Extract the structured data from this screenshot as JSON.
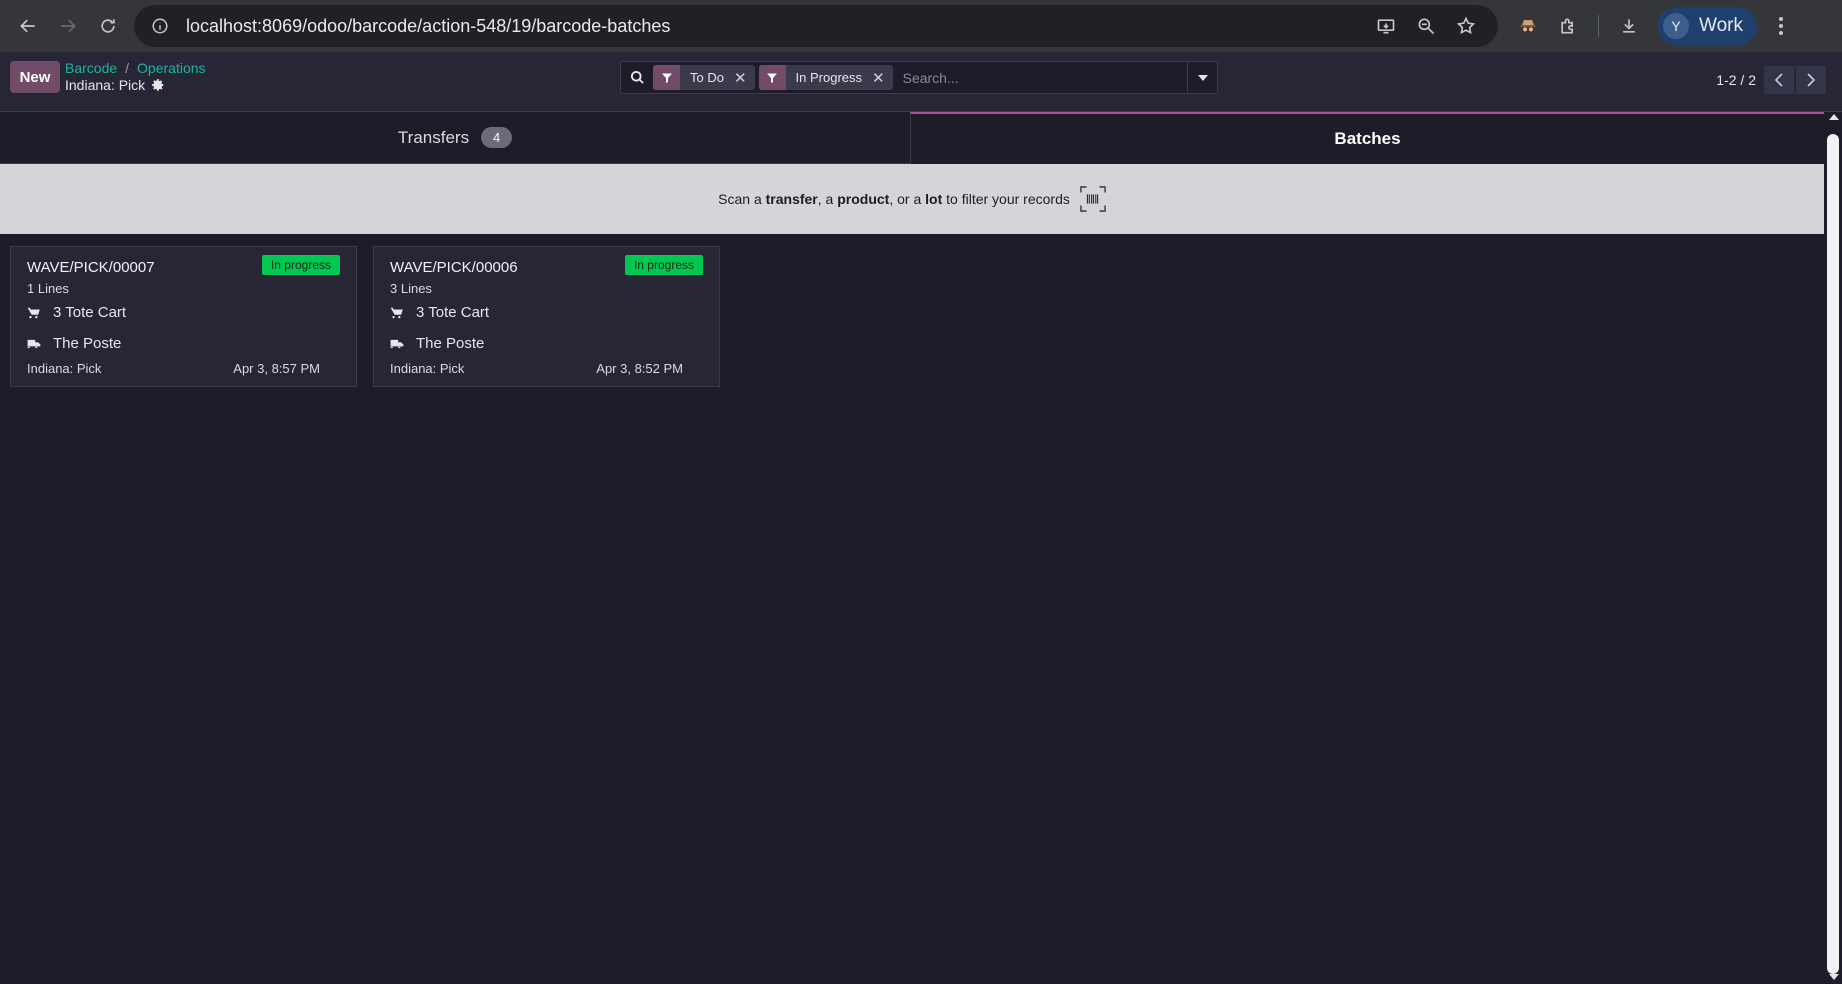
{
  "browser": {
    "url": "localhost:8069/odoo/barcode/action-548/19/barcode-batches",
    "profile_initial": "Y",
    "profile_name": "Work"
  },
  "control_panel": {
    "new_label": "New",
    "breadcrumb": [
      "Barcode",
      "Operations"
    ],
    "breadcrumb_separator": "/",
    "current_page": "Indiana: Pick",
    "facets": [
      {
        "label": "To Do"
      },
      {
        "label": "In Progress"
      }
    ],
    "search_placeholder": "Search...",
    "pager_value": "1-2 / 2"
  },
  "tabs": {
    "transfers_label": "Transfers",
    "transfers_count": "4",
    "batches_label": "Batches"
  },
  "scan_banner": {
    "part1": "Scan a ",
    "bold1": "transfer",
    "part2": ", a ",
    "bold2": "product",
    "part3": ", or a ",
    "bold3": "lot",
    "part4": " to filter your records"
  },
  "batches": [
    {
      "name": "WAVE/PICK/00007",
      "status": "In progress",
      "lines": "1 Lines",
      "cart": "3 Tote Cart",
      "carrier": "The Poste",
      "operation": "Indiana: Pick",
      "date": "Apr 3, 8:57 PM"
    },
    {
      "name": "WAVE/PICK/00006",
      "status": "In progress",
      "lines": "3 Lines",
      "cart": "3 Tote Cart",
      "carrier": "The Poste",
      "operation": "Indiana: Pick",
      "date": "Apr 3, 8:52 PM"
    }
  ],
  "colors": {
    "brand": "#714b67",
    "accent_link": "#1fb3a6",
    "status_green": "#00c853",
    "background": "#1d1c28"
  }
}
